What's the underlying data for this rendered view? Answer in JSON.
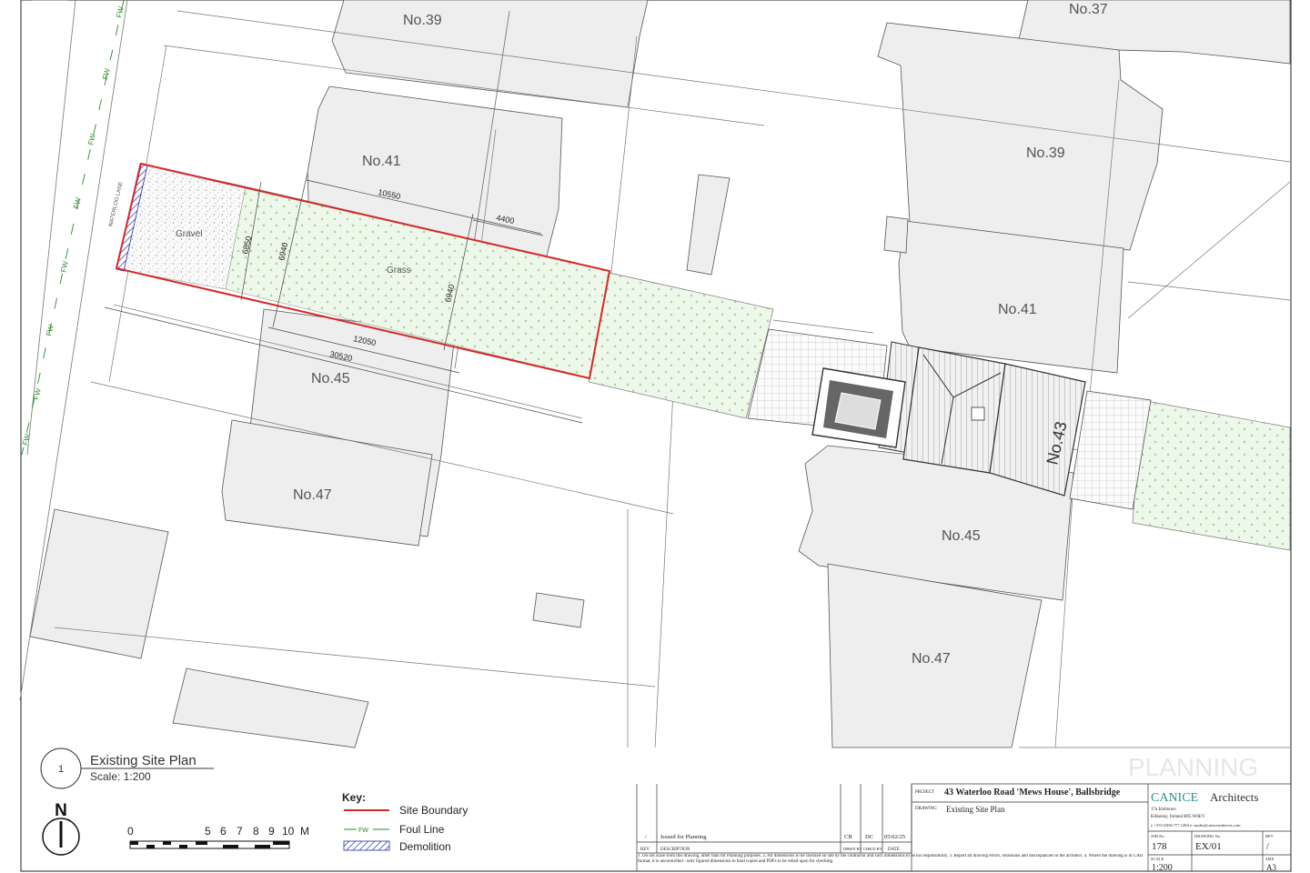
{
  "plot_labels": [
    {
      "key": "no39_top",
      "text": "No.39"
    },
    {
      "key": "no37",
      "text": "No.37"
    },
    {
      "key": "no41_left",
      "text": "No.41"
    },
    {
      "key": "no39_right",
      "text": "No.39"
    },
    {
      "key": "no41_right",
      "text": "No.41"
    },
    {
      "key": "no45_left",
      "text": "No.45"
    },
    {
      "key": "no47_left",
      "text": "No.47"
    },
    {
      "key": "no45_right",
      "text": "No.45"
    },
    {
      "key": "no47_right",
      "text": "No.47"
    },
    {
      "key": "no43",
      "text": "No.43"
    }
  ],
  "site": {
    "lane_label": "WATERLOO LANE",
    "gravel_label": "Gravel",
    "grass_label": "Grass",
    "foul_label": "FW",
    "dims": {
      "d10550": "10550",
      "d4400": "4400",
      "d6850": "6850",
      "d6940a": "6940",
      "d6940b": "6940",
      "d12050": "12050",
      "d30520": "30520"
    }
  },
  "title_block": {
    "drawing_number": "1",
    "drawing_title": "Existing Site Plan",
    "scale_text": "Scale: 1:200",
    "north": "N",
    "scalebar_labels": [
      "0",
      "5",
      "6",
      "7",
      "8",
      "9",
      "10",
      "M"
    ],
    "key_title": "Key:",
    "key_items": [
      {
        "label": "Site Boundary",
        "color": "#d62828"
      },
      {
        "label": "Foul Line",
        "color": "#2a8a2a",
        "code": "FW"
      },
      {
        "label": "Demolition",
        "color": "#2233aa"
      }
    ],
    "watermark": "PLANNING",
    "revision": {
      "rev": "/",
      "description": "Issued for Planning",
      "drwn": "CB",
      "chkd": "DC",
      "date": "05/02/25",
      "headers": [
        "REV",
        "DESCRIPTION",
        "DRWN BY",
        "CHK'D BY",
        "DATE"
      ]
    },
    "notes": "1.  Do not scale from this drawing, other than for Planning purposes. 2. All dimensions to be checked on site by the contractor and such dimensions to be his responsibility. 3. Report all drawing errors, omissions and discrepancies to the architect. 4. Where the drawing is in CAD format, it is uncontrolled - only figured dimensions in hard copies and PDFs to be relied upon for checking.",
    "project_label": "PROJECT",
    "project": "43 Waterloo Road 'Mews House', Ballsbridge",
    "drawing_label": "DRAWING",
    "drawing": "Existing Site Plan",
    "firm_main": "CANICE",
    "firm_sub": "Architects",
    "firm_address": [
      "17a Irishtown",
      "Kilkenny, Ireland R95 W6EV",
      "t: +353 (0)56 777 1494   e: studio@caniceachitects.com"
    ],
    "job_no_label": "JOB No.",
    "job_no": "178",
    "drawing_no_label": "DRAWING No.",
    "drawing_no": "EX/01",
    "rev_label": "REV",
    "rev": "/",
    "scale_label": "SCALE",
    "scale": "1:200",
    "size_label": "SIZE",
    "size": "A3"
  }
}
